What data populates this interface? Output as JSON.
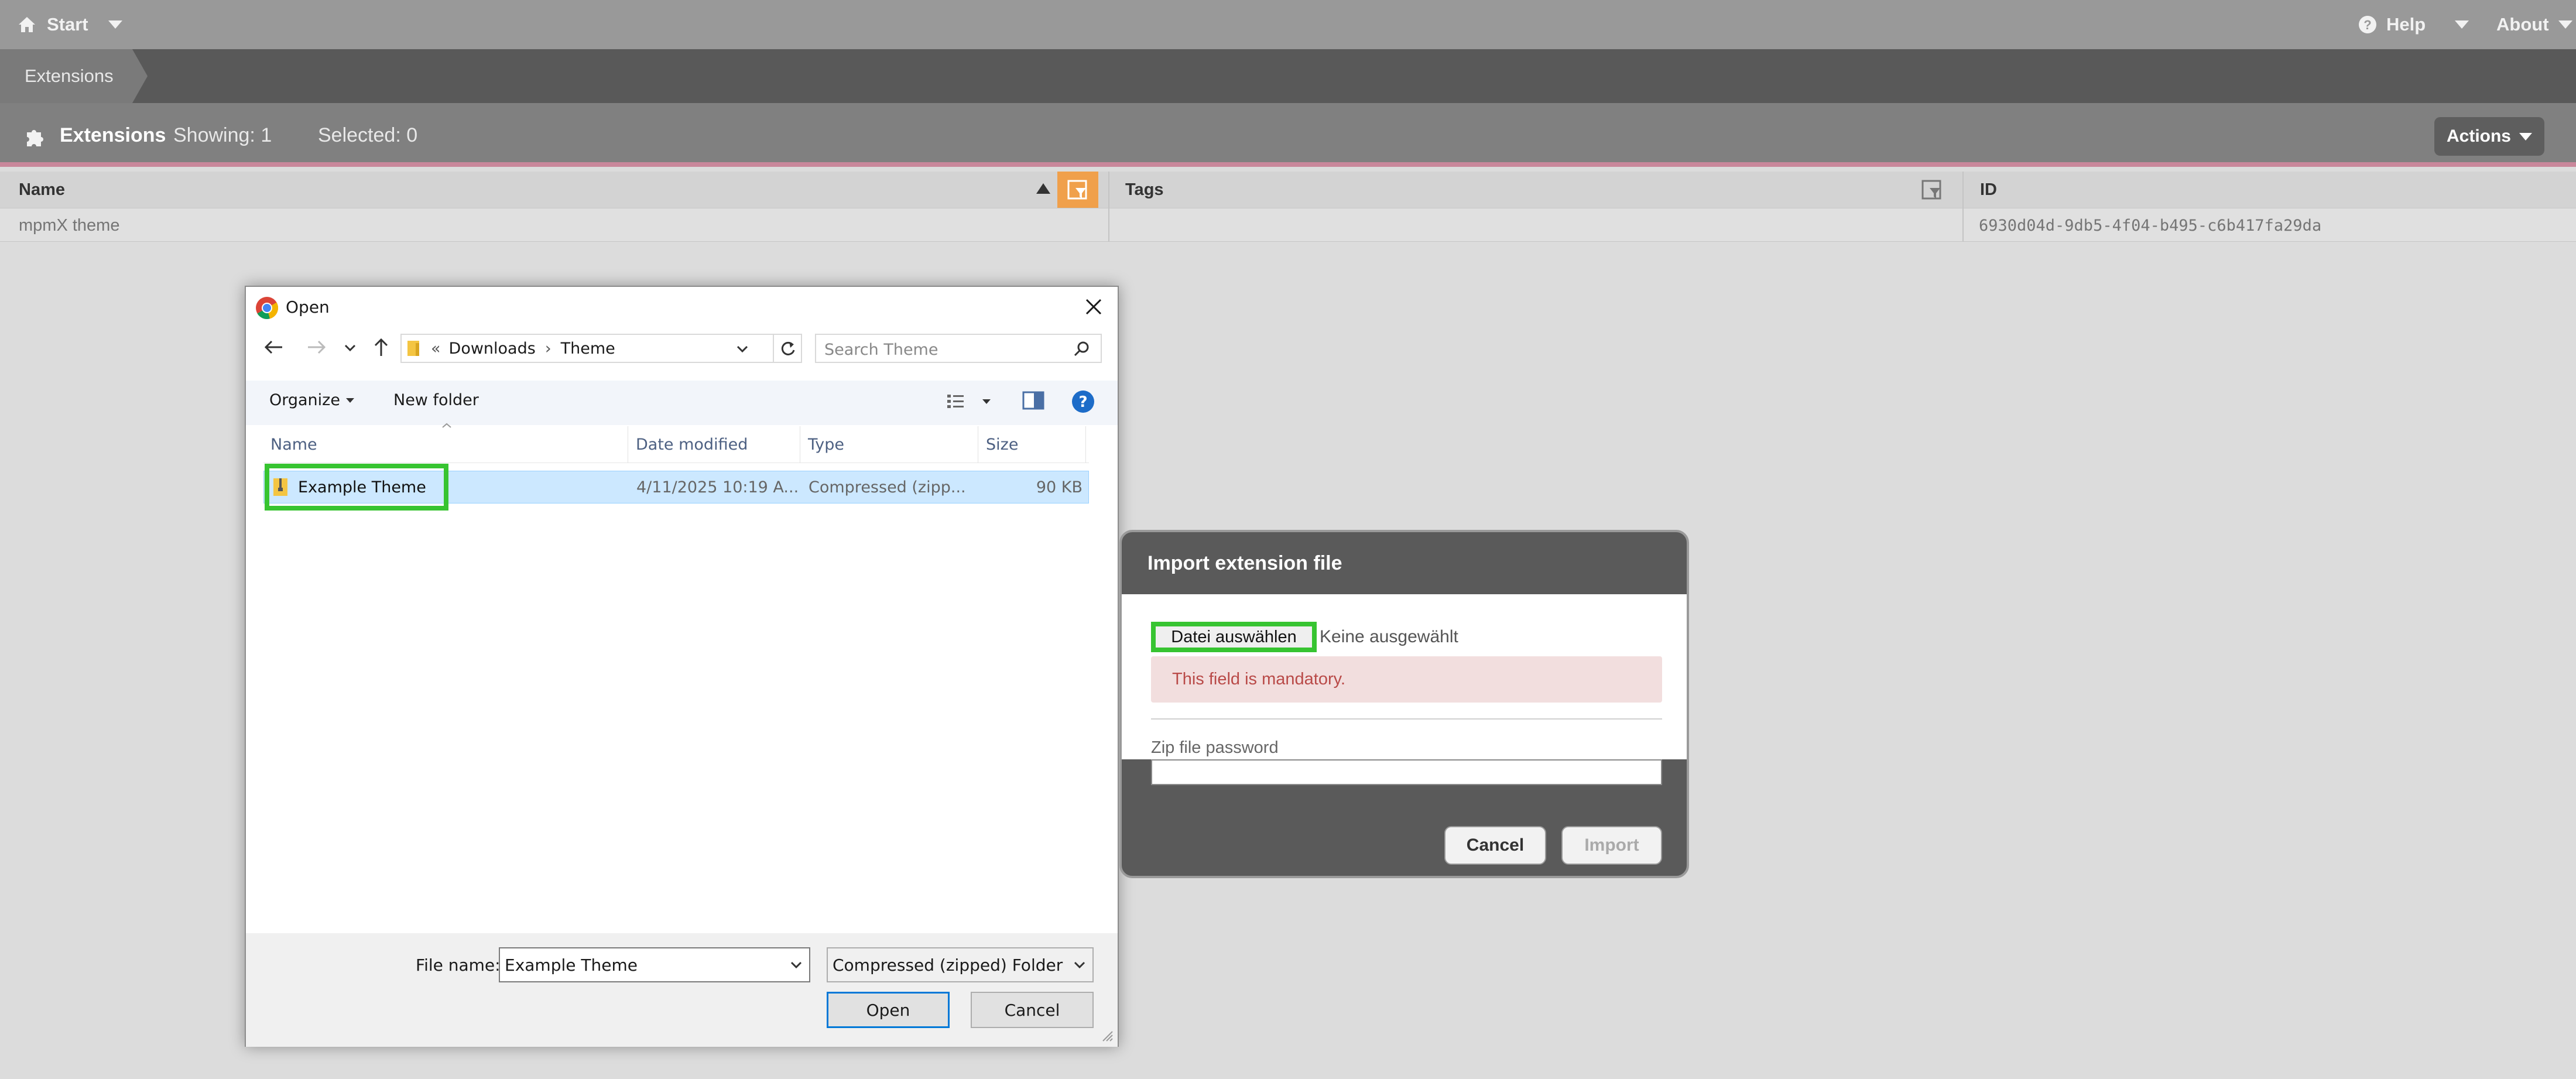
{
  "app": {
    "start_label": "Start",
    "help_label": "Help",
    "about_label": "About",
    "breadcrumb": "Extensions"
  },
  "toolbar": {
    "title": "Extensions",
    "showing": "Showing: 1",
    "selected": "Selected: 0",
    "actions_label": "Actions"
  },
  "grid": {
    "columns": [
      "Name",
      "Tags",
      "ID"
    ],
    "rows": [
      {
        "name": "mpmX theme",
        "tags": "",
        "id": "6930d04d-9db5-4f04-b495-c6b417fa29da"
      }
    ]
  },
  "open_dialog": {
    "title": "Open",
    "path_prefix": "«",
    "path": [
      "Downloads",
      "Theme"
    ],
    "search_placeholder": "Search Theme",
    "organize_label": "Organize",
    "new_folder_label": "New folder",
    "columns": [
      "Name",
      "Date modified",
      "Type",
      "Size"
    ],
    "files": [
      {
        "name": "Example Theme",
        "date": "4/11/2025 10:19 A...",
        "type": "Compressed (zipp...",
        "size": "90 KB"
      }
    ],
    "file_name_label": "File name:",
    "file_name_value": "Example Theme",
    "file_type_value": "Compressed (zipped) Folder",
    "open_label": "Open",
    "cancel_label": "Cancel"
  },
  "import_modal": {
    "title": "Import extension file",
    "choose_file_label": "Datei auswählen",
    "no_file_label": "Keine ausgewählt",
    "error_text": "This field is mandatory.",
    "zip_password_label": "Zip file password",
    "zip_password_value": "",
    "cancel_label": "Cancel",
    "import_label": "Import"
  },
  "colors": {
    "highlight": "#37c431",
    "filter_active": "#f0a04b",
    "error_bg": "#f2dede",
    "error_text": "#b94a48",
    "selection": "#cce8ff"
  }
}
